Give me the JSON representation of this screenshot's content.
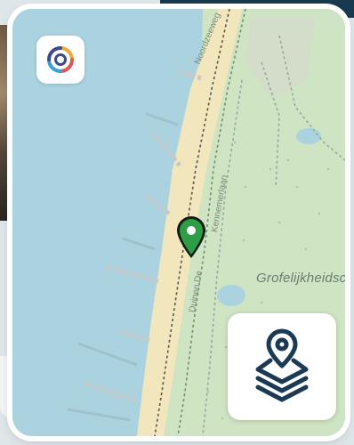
{
  "map": {
    "place_label": "Grofelijkheidsc",
    "road_labels": [
      "Noordzeeweg",
      "Duinen De",
      "Kennemerlaan"
    ]
  },
  "controls": {
    "logo_icon": "multicolor-ring-logo-icon",
    "layers_icon": "map-layers-pin-icon"
  },
  "marker": {
    "icon": "location-pin-icon",
    "color": "#2e9e46"
  },
  "colors": {
    "water": "#aad3df",
    "land": "#cfe4c3",
    "beach": "#f2e6bd",
    "accent": "#1a3a55"
  }
}
